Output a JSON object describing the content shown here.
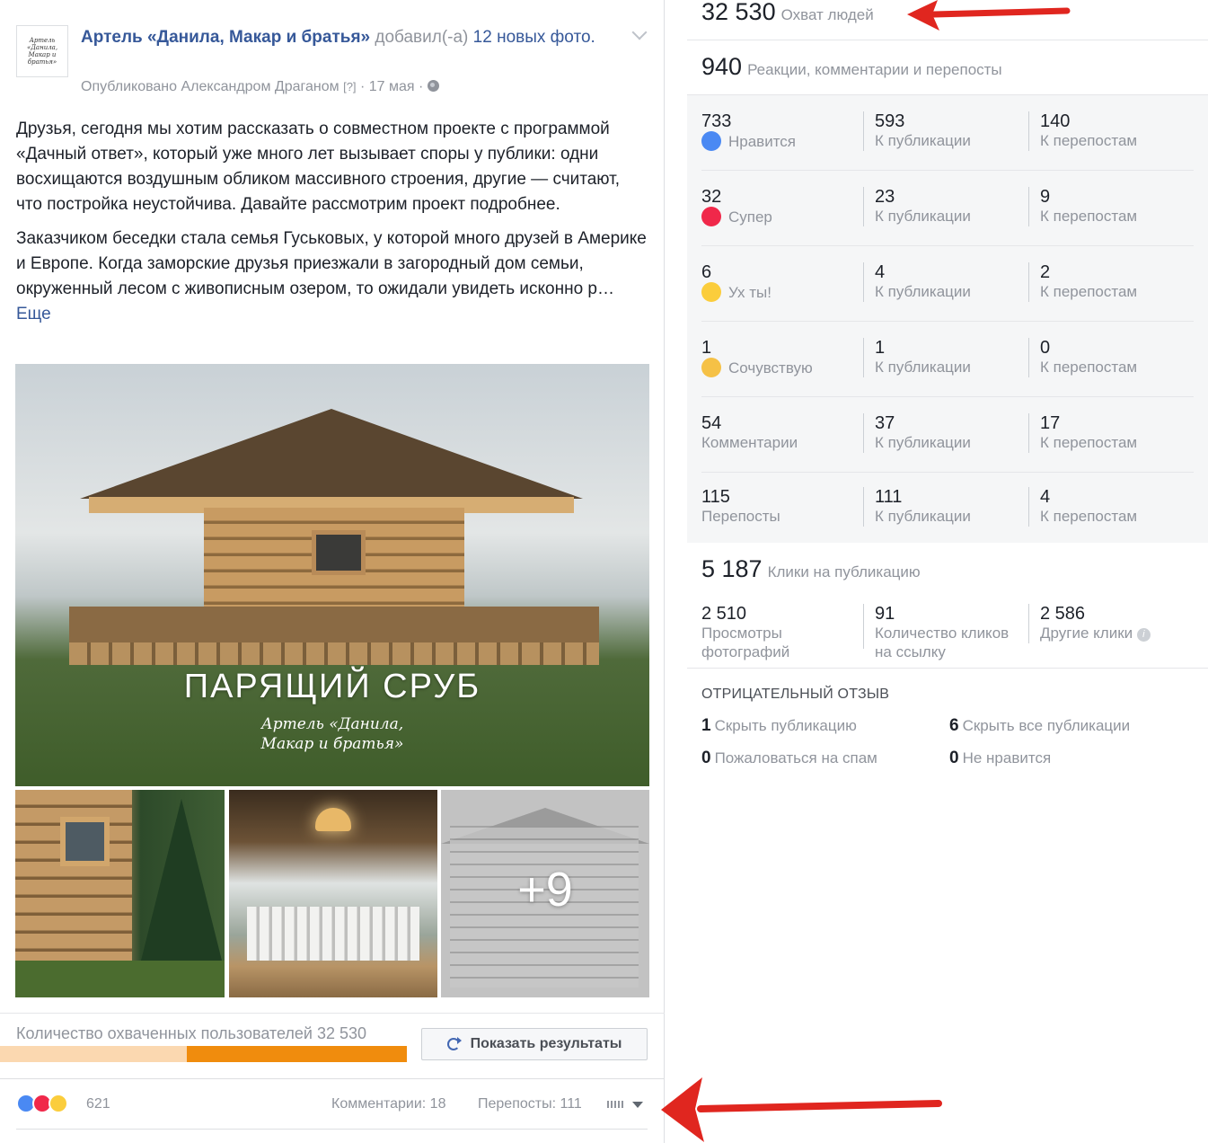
{
  "post": {
    "page_name": "Артель «Данила, Макар и братья»",
    "added_text": " добавил(-а) ",
    "photos_link": "12 новых фото.",
    "published_by": "Опубликовано Александром Драганом ",
    "help_mark": "[?]",
    "date": " · 17 мая · ",
    "avatar_text": "Артель «Данила, Макар и братья»",
    "paragraph1": "Друзья, сегодня мы хотим рассказать о совместном проекте с программой «Дачный ответ», который уже много лет вызывает споры у публики: одни восхищаются воздушным обликом массивного строения, другие — считают, что постройка неустойчива. Давайте рассмотрим проект подробнее.",
    "paragraph2": "Заказчиком беседки стала семья Гуськовых, у которой много друзей в Америке и Европе. Когда заморские друзья приезжали в загородный дом семьи, окруженный лесом с живописным озером, то ожидали увидеть исконно р… ",
    "more_link": "Еще",
    "photo_title": "ПАРЯЩИЙ СРУБ",
    "photo_sign_line1": "Артель «Данила,",
    "photo_sign_line2": "Макар и братья»",
    "more_photos": "+9",
    "reach_label": "Количество охваченных пользователей 32 530",
    "reach_progress_organic_fraction": 0.46,
    "show_results": "Показать результаты",
    "reactions_count": "621",
    "comments": "Комментарии: 18",
    "shares": "Перепосты: 111",
    "icons": [
      "globe-icon",
      "chevron-down-icon",
      "refresh-icon",
      "like-icon",
      "love-icon",
      "wow-icon",
      "dropdown-icon"
    ]
  },
  "insights": {
    "reach": {
      "value": "32 530",
      "label": "Охват людей"
    },
    "engagement": {
      "value": "940",
      "label": "Реакции, комментарии и перепосты"
    },
    "rows": [
      {
        "total": "733",
        "name": "Нравится",
        "icon": "like-icon",
        "post": "593",
        "post_label": "К публикации",
        "shares": "140",
        "shares_label": "К перепостам"
      },
      {
        "total": "32",
        "name": "Супер",
        "icon": "love-icon",
        "post": "23",
        "post_label": "К публикации",
        "shares": "9",
        "shares_label": "К перепостам"
      },
      {
        "total": "6",
        "name": "Ух ты!",
        "icon": "wow-icon",
        "post": "4",
        "post_label": "К публикации",
        "shares": "2",
        "shares_label": "К перепостам"
      },
      {
        "total": "1",
        "name": "Сочувствую",
        "icon": "sad-icon",
        "post": "1",
        "post_label": "К публикации",
        "shares": "0",
        "shares_label": "К перепостам"
      },
      {
        "total": "54",
        "name": "Комментарии",
        "icon": "",
        "post": "37",
        "post_label": "К публикации",
        "shares": "17",
        "shares_label": "К перепостам"
      },
      {
        "total": "115",
        "name": "Перепосты",
        "icon": "",
        "post": "111",
        "post_label": "К публикации",
        "shares": "4",
        "shares_label": "К перепостам"
      }
    ],
    "clicks": {
      "value": "5 187",
      "label": "Клики на публикацию"
    },
    "click_cells": [
      {
        "value": "2 510",
        "label_line1": "Просмотры",
        "label_line2": "фотографий"
      },
      {
        "value": "91",
        "label_line1": "Количество кликов",
        "label_line2": "на ссылку"
      },
      {
        "value": "2 586",
        "label_line1": "Другие клики",
        "label_line2": ""
      }
    ],
    "negative_title": "ОТРИЦАТЕЛЬНЫЙ ОТЗЫВ",
    "negative": [
      {
        "value": "1",
        "label": "Скрыть публикацию"
      },
      {
        "value": "6",
        "label": "Скрыть все публикации"
      },
      {
        "value": "0",
        "label": "Пожаловаться на спам"
      },
      {
        "value": "0",
        "label": "Не нравится"
      }
    ]
  },
  "colors": {
    "link": "#365899",
    "muted": "#90949c",
    "arrow": "#e0261f",
    "progress": "#f08c0d"
  }
}
